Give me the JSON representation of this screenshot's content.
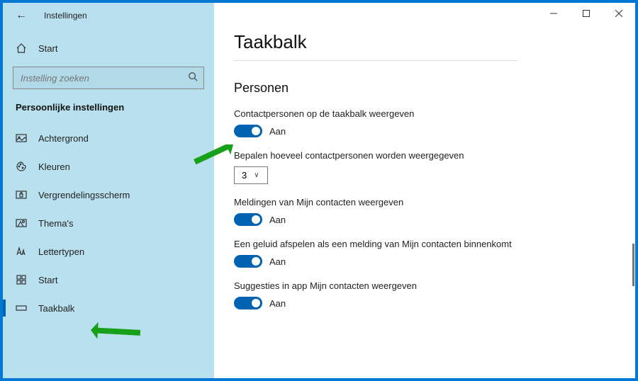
{
  "window": {
    "title": "Instellingen"
  },
  "sidebar": {
    "home": "Start",
    "search_placeholder": "Instelling zoeken",
    "category": "Persoonlijke instellingen",
    "items": [
      {
        "icon": "image",
        "label": "Achtergrond"
      },
      {
        "icon": "palette",
        "label": "Kleuren"
      },
      {
        "icon": "lock",
        "label": "Vergrendelingsscherm"
      },
      {
        "icon": "theme",
        "label": "Thema's"
      },
      {
        "icon": "font",
        "label": "Lettertypen"
      },
      {
        "icon": "start",
        "label": "Start"
      },
      {
        "icon": "taskbar",
        "label": "Taakbalk"
      }
    ],
    "active_index": 6
  },
  "page": {
    "title": "Taakbalk",
    "section": "Personen",
    "settings": [
      {
        "label": "Contactpersonen op de taakbalk weergeven",
        "type": "toggle",
        "state": "Aan"
      },
      {
        "label": "Bepalen hoeveel contactpersonen worden weergegeven",
        "type": "dropdown",
        "value": "3"
      },
      {
        "label": "Meldingen van Mijn contacten weergeven",
        "type": "toggle",
        "state": "Aan"
      },
      {
        "label": "Een geluid afspelen als een melding van Mijn contacten binnenkomt",
        "type": "toggle",
        "state": "Aan"
      },
      {
        "label": "Suggesties in app Mijn contacten weergeven",
        "type": "toggle",
        "state": "Aan"
      }
    ]
  }
}
